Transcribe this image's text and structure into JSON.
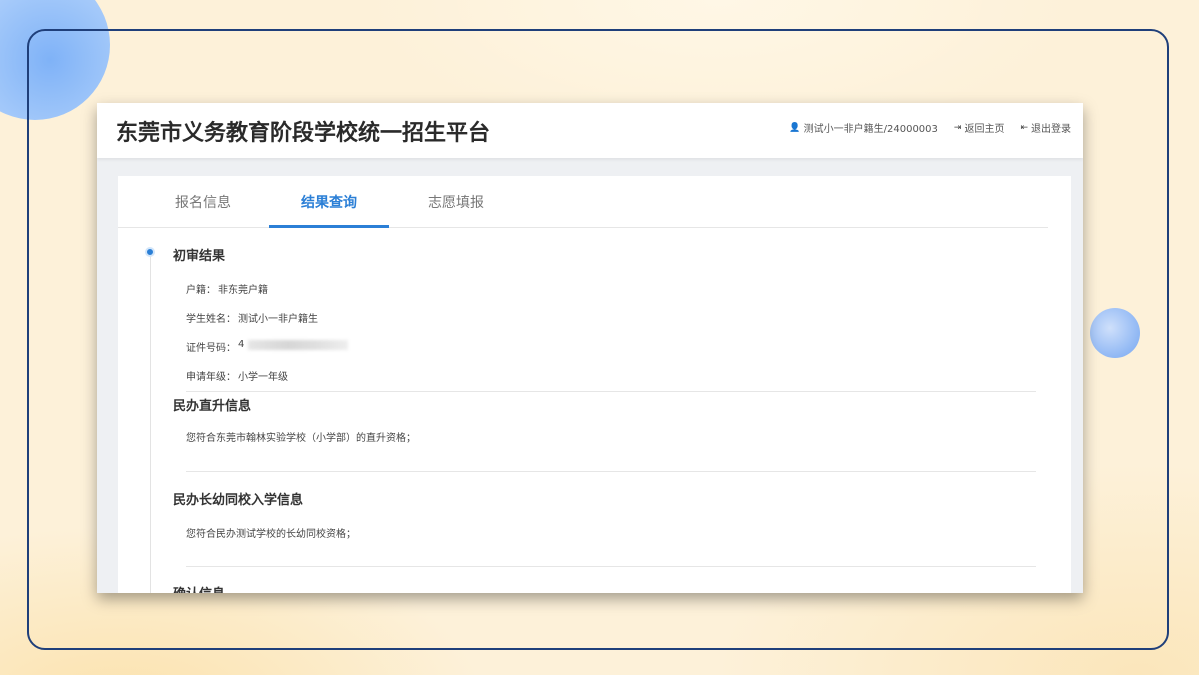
{
  "header": {
    "site_title": "东莞市义务教育阶段学校统一招生平台",
    "user": "测试小一非户籍生/24000003",
    "home_link": "返回主页",
    "logout_link": "退出登录"
  },
  "tabs": [
    {
      "label": "报名信息",
      "active": false
    },
    {
      "label": "结果查询",
      "active": true
    },
    {
      "label": "志愿填报",
      "active": false
    }
  ],
  "sections": {
    "review": {
      "title": "初审结果",
      "fields": [
        {
          "label": "户籍：",
          "value": "非东莞户籍"
        },
        {
          "label": "学生姓名：",
          "value": "测试小一非户籍生"
        },
        {
          "label": "证件号码：",
          "value": "4"
        },
        {
          "label": "申请年级：",
          "value": "小学一年级"
        }
      ]
    },
    "private_upgrade": {
      "title": "民办直升信息",
      "text": "您符合东莞市翰林实验学校（小学部）的直升资格；"
    },
    "private_sibling": {
      "title": "民办长幼同校入学信息",
      "text": "您符合民办测试学校的长幼同校资格；"
    },
    "confirm": {
      "title": "确认信息"
    }
  },
  "colors": {
    "accent": "#2b7fd6",
    "frame": "#1f3f7a",
    "background": "#fdf1d9"
  },
  "icons": [
    "user-icon",
    "sign-in-icon",
    "sign-out-icon"
  ]
}
